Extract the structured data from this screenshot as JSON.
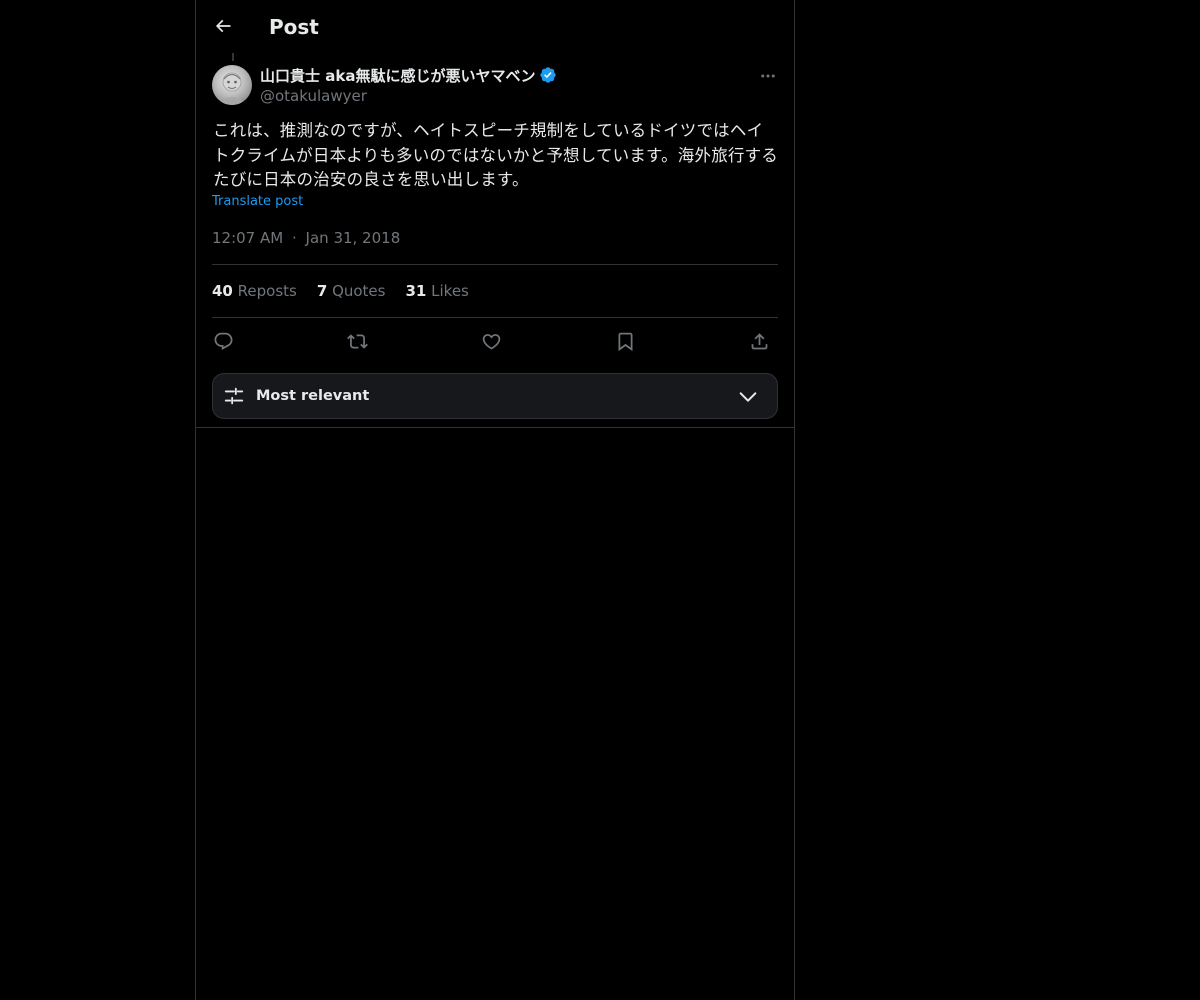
{
  "header": {
    "title": "Post",
    "back_icon": "arrow-left-icon"
  },
  "post": {
    "author": {
      "display_name": "山口貴士 aka無駄に感じが悪いヤマベン",
      "handle": "@otakulawyer",
      "verified": true,
      "verified_color": "#1d9bf0"
    },
    "text": "これは、推測なのですが、ヘイトスピーチ規制をしているドイツではヘイトクライムが日本よりも多いのではないかと予想しています。海外旅行するたびに日本の治安の良さを思い出します。",
    "translate_label": "Translate post",
    "time": "12:07 AM",
    "date": "Jan 31, 2018",
    "separator": "·"
  },
  "stats": {
    "reposts_count": "40",
    "reposts_label": "Reposts",
    "quotes_count": "7",
    "quotes_label": "Quotes",
    "likes_count": "31",
    "likes_label": "Likes"
  },
  "actions": [
    "reply-icon",
    "repost-icon",
    "like-icon",
    "bookmark-icon",
    "share-icon"
  ],
  "sort": {
    "label": "Most relevant",
    "icon": "sliders-icon",
    "chevron": "chevron-down-icon"
  },
  "colors": {
    "background": "#000000",
    "text_primary": "#e7e9ea",
    "text_secondary": "#71767b",
    "accent": "#1d9bf0",
    "border": "#2f3336"
  }
}
